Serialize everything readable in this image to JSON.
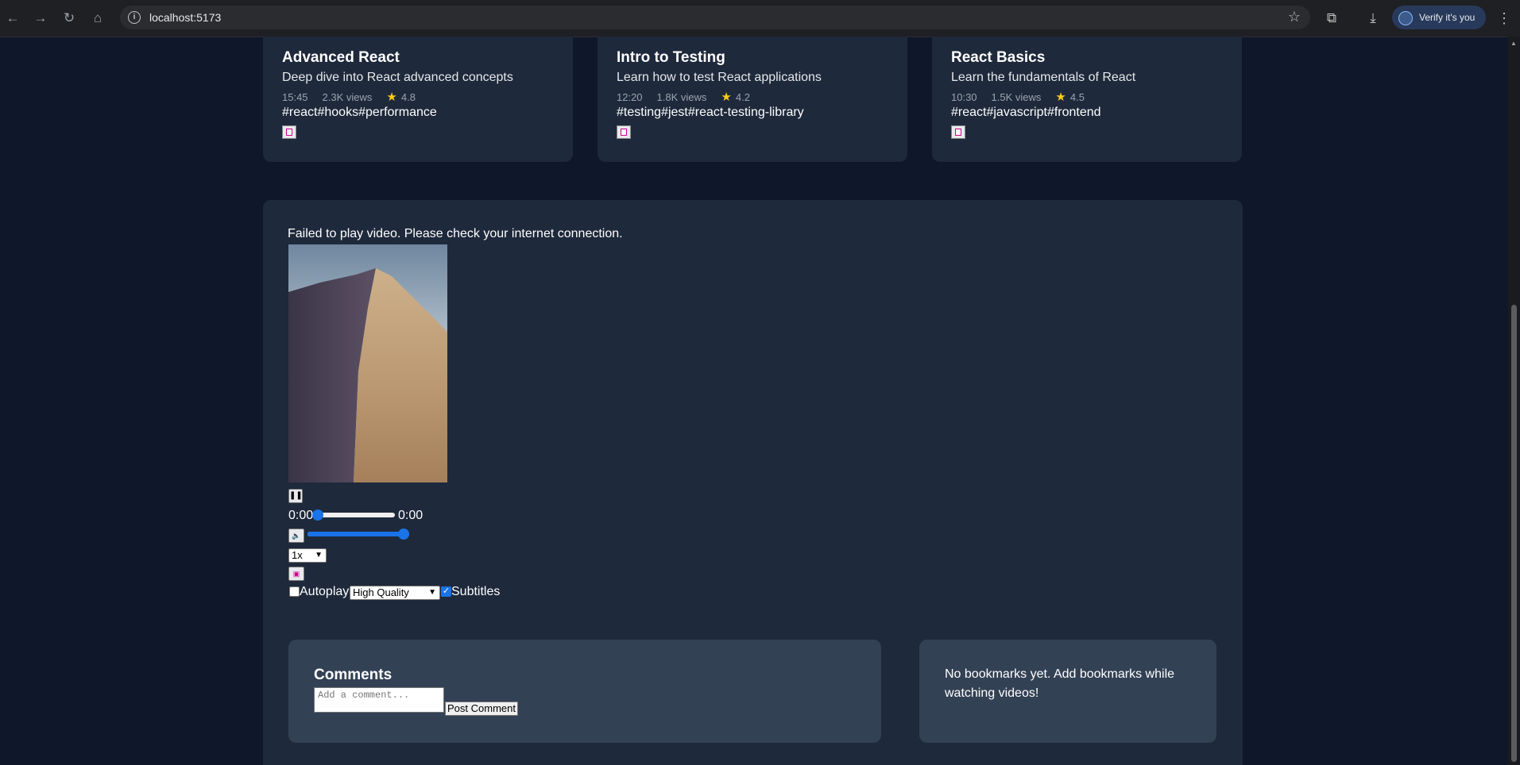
{
  "browser": {
    "url": "localhost:5173",
    "verify_label": "Verify it's you"
  },
  "cards": [
    {
      "title": "Advanced React",
      "description": "Deep dive into React advanced concepts",
      "duration": "15:45",
      "views": "2.3K views",
      "rating": "4.8",
      "tags": "#react#hooks#performance"
    },
    {
      "title": "Intro to Testing",
      "description": "Learn how to test React applications",
      "duration": "12:20",
      "views": "1.8K views",
      "rating": "4.2",
      "tags": "#testing#jest#react-testing-library"
    },
    {
      "title": "React Basics",
      "description": "Learn the fundamentals of React",
      "duration": "10:30",
      "views": "1.5K views",
      "rating": "4.5",
      "tags": "#react#javascript#frontend"
    }
  ],
  "player": {
    "error": "Failed to play video. Please check your internet connection.",
    "pause_icon": "pause-icon",
    "current_time": "0:00",
    "total_time": "0:00",
    "progress": 0,
    "volume": 1,
    "speed": "1x",
    "autoplay_label": "Autoplay",
    "autoplay_checked": false,
    "quality": "High Quality",
    "subtitles_label": "Subtitles",
    "subtitles_checked": true
  },
  "comments": {
    "title": "Comments",
    "placeholder": "Add a comment...",
    "post_label": "Post Comment"
  },
  "bookmarks": {
    "empty_text": "No bookmarks yet. Add bookmarks while watching videos!"
  },
  "colors": {
    "page_bg": "#0f172a",
    "card_bg": "#1e293b",
    "panel_bg": "#334155",
    "accent": "#1a73e8",
    "star": "#facc15"
  }
}
